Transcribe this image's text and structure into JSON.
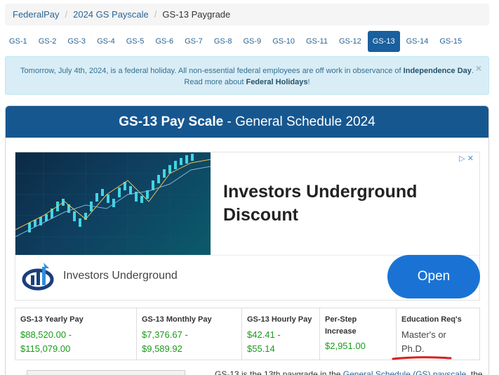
{
  "breadcrumb": {
    "items": [
      "FederalPay",
      "2024 GS Payscale"
    ],
    "current": "GS-13 Paygrade"
  },
  "tabs": [
    "GS-1",
    "GS-2",
    "GS-3",
    "GS-4",
    "GS-5",
    "GS-6",
    "GS-7",
    "GS-8",
    "GS-9",
    "GS-10",
    "GS-11",
    "GS-12",
    "GS-13",
    "GS-14",
    "GS-15"
  ],
  "active_tab": "GS-13",
  "alert": {
    "text_pre": "Tomorrow, July 4th, 2024, is a federal holiday. All non-essential federal employees are off work in observance of",
    "holiday": "Independence Day",
    "text_mid": "Read more about",
    "link": "Federal Holidays",
    "text_end": "!",
    "close": "×"
  },
  "panel": {
    "title_bold": "GS-13 Pay Scale",
    "title_rest": " - General Schedule 2024"
  },
  "ad": {
    "title": "Investors Underground Discount",
    "brand": "Investors Underground",
    "open_label": "Open",
    "badge": "▷ ✕"
  },
  "stats": [
    {
      "label": "GS-13 Yearly Pay",
      "value1": "$88,520.00 -",
      "value2": "$115,079.00"
    },
    {
      "label": "GS-13 Monthly Pay",
      "value1": "$7,376.67 -",
      "value2": "$9,589.92"
    },
    {
      "label": "GS-13 Hourly Pay",
      "value1": "$42.41 -",
      "value2": "$55.14"
    },
    {
      "label1": "Per-Step",
      "label2": "Increase",
      "value": "$2,951.00"
    },
    {
      "label": "Education Req's",
      "value1": "Master's or",
      "value2": "Ph.D."
    }
  ],
  "intro": {
    "pre": "GS-13 is the 13th paygrade in the",
    "link": "General Schedule (GS) payscale",
    "post": ", the"
  },
  "colors": {
    "header_blue": "#17578f",
    "active_tab": "#1a5f9e",
    "pay_green": "#1a9a1a",
    "open_button": "#1a73d4",
    "underline_red": "#d62020"
  }
}
